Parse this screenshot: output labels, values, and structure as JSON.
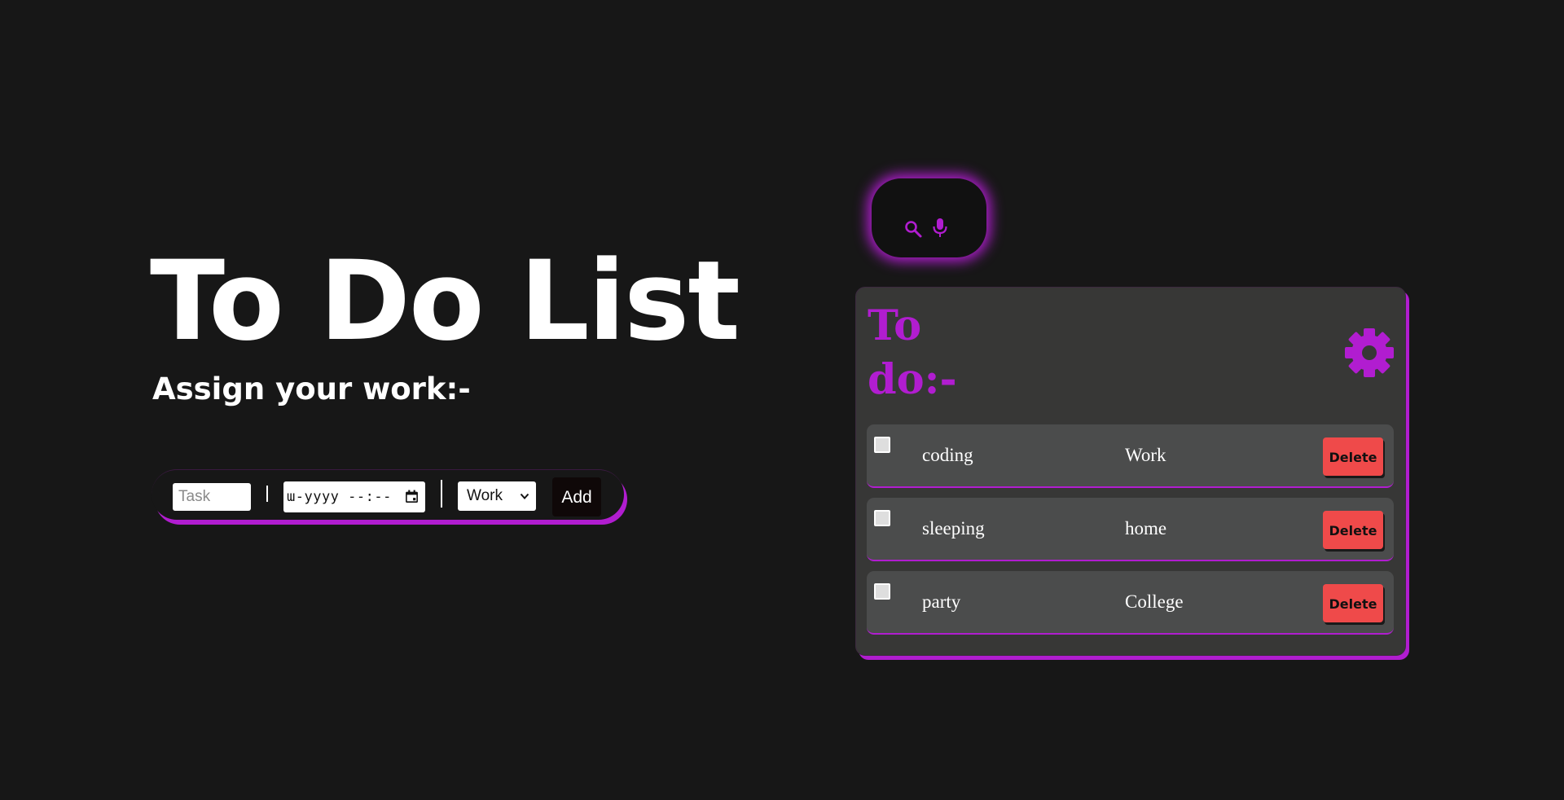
{
  "header": {
    "title": "To Do List",
    "subtitle": "Assign your work:-"
  },
  "form": {
    "task_placeholder": "Task",
    "task_value": "",
    "separator": "|",
    "date_value": "ɯ-yyyy --:--",
    "category_selected": "Work",
    "add_label": "Add"
  },
  "search": {
    "search_icon": "search-icon",
    "mic_icon": "microphone-icon"
  },
  "todo": {
    "heading": "To do:-",
    "settings_icon": "gear-icon",
    "items": [
      {
        "task": "coding",
        "category": "Work",
        "done": false,
        "delete_label": "Delete"
      },
      {
        "task": "sleeping",
        "category": "home",
        "done": false,
        "delete_label": "Delete"
      },
      {
        "task": "party",
        "category": "College",
        "done": false,
        "delete_label": "Delete"
      }
    ]
  },
  "colors": {
    "background": "#171717",
    "accent": "#b11dd0",
    "panel": "#373736",
    "item": "#4b4c4c",
    "delete": "#ef4a4a"
  }
}
